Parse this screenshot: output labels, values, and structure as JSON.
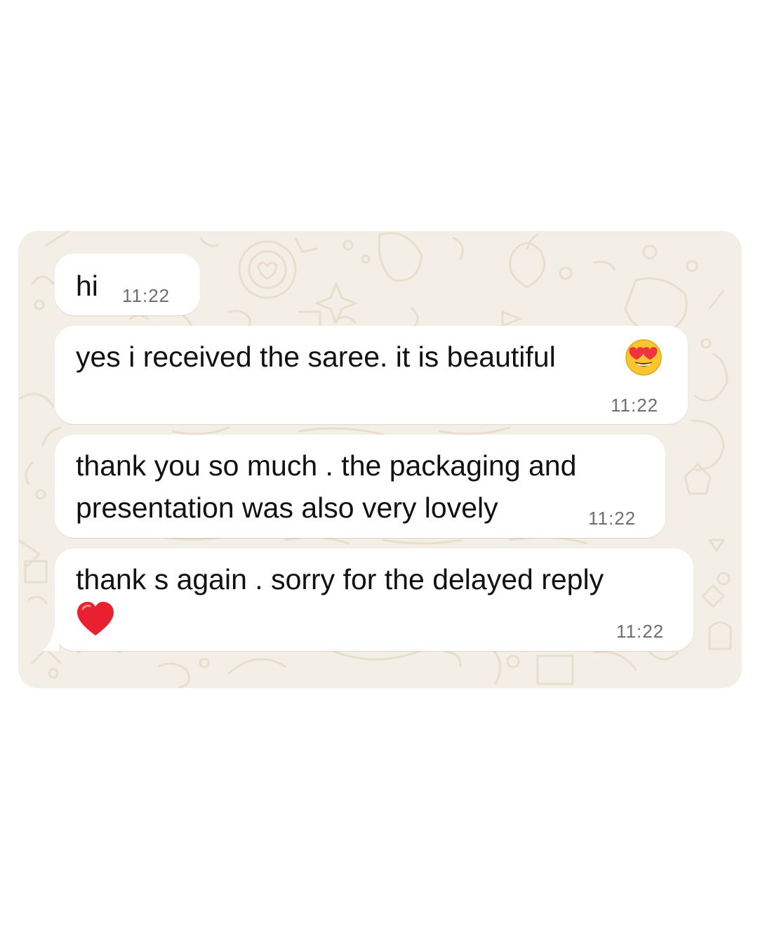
{
  "chat": {
    "messages": [
      {
        "text": "hi",
        "time": "11:22"
      },
      {
        "text": "yes i received the saree. it is beautiful",
        "emoji": "heart-eyes-emoji",
        "time": "11:22"
      },
      {
        "lines": [
          "thank you so much . the packaging and",
          "presentation was also very lovely"
        ],
        "time": "11:22"
      },
      {
        "text": "thank s again . sorry for the delayed reply",
        "emoji": "red-heart-emoji",
        "time": "11:22"
      }
    ]
  },
  "colors": {
    "page_background": "#ffffff",
    "chat_wallpaper": "#f4efe6",
    "wallpaper_doodle": "#e9e0cf",
    "bubble_incoming": "#ffffff",
    "message_text": "#111111",
    "timestamp_text": "#6e6e6e"
  }
}
